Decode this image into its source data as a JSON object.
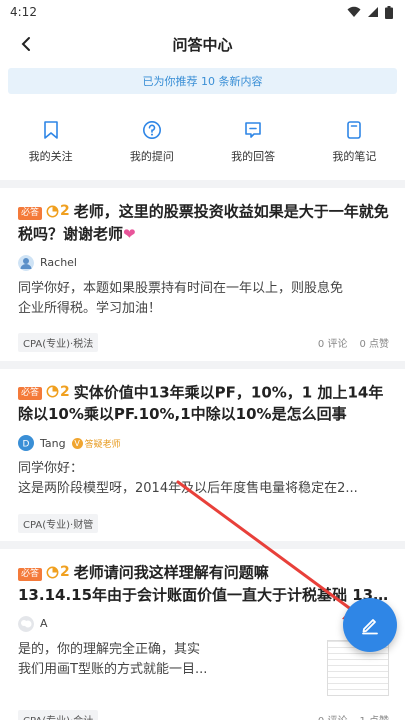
{
  "status": {
    "time": "4:12"
  },
  "nav": {
    "title": "问答中心"
  },
  "banner": {
    "text": "已为你推荐 10 条新内容"
  },
  "shortcuts": [
    {
      "label": "我的关注",
      "icon": "bookmark-icon"
    },
    {
      "label": "我的提问",
      "icon": "question-icon"
    },
    {
      "label": "我的回答",
      "icon": "comment-icon"
    },
    {
      "label": "我的笔记",
      "icon": "note-icon"
    }
  ],
  "tag_label": "必答",
  "posts": [
    {
      "coins": "2",
      "title": "老师，这里的股票投资收益如果是大于一年就免税吗？谢谢老师",
      "title_emoji": "❤",
      "author": "Rachel",
      "answer_lines": [
        "同学你好，本题如果股票持有时间在一年以上，则股息免",
        "企业所得税。学习加油！"
      ],
      "category": "CPA(专业)·税法",
      "comments": "0 评论",
      "likes": "0 点赞"
    },
    {
      "coins": "2",
      "title": "实体价值中13年乘以PF，10%，1 加上14年除以10%乘以PF.10%,1中除以10%是怎么回事",
      "author": "Tang",
      "author_badge": "答疑老师",
      "answer_lines": [
        "同学你好：",
        "这是两阶段模型呀，2014年及以后年度售电量将稳定在2..."
      ],
      "category": "CPA(专业)·财管"
    },
    {
      "coins": "2",
      "title_line1": "老师请问我这样理解有问题嘛",
      "title_line2": "13.14.15年由于会计账面价值一直大于计税基础 13年80...",
      "author": "A",
      "answer_lines": [
        "是的，你的理解完全正确，其实",
        "我们用画T型账的方式就能一目..."
      ],
      "category": "CPA(专业)·会计",
      "comments": "0 评论",
      "likes": "1 点赞"
    }
  ],
  "colors": {
    "accent": "#2f86e6",
    "must_tag": "#f47a3a",
    "coin": "#f0a020",
    "annotation_arrow": "#e8403a"
  }
}
